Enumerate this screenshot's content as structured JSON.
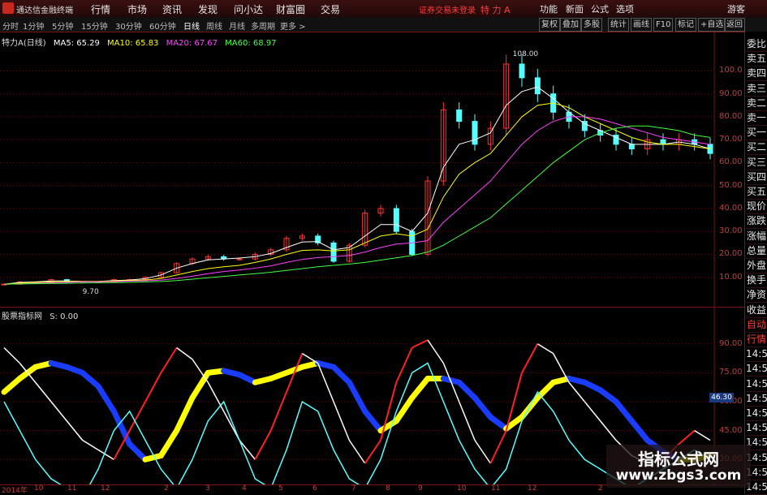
{
  "app_title": "通达信金融终端",
  "menu": [
    "行情",
    "市场",
    "资讯",
    "发现",
    "问小达",
    "财富圈",
    "交易"
  ],
  "login_note": "证券交易未登录",
  "stock_title": "特 力 A",
  "top_right": [
    "功能",
    "新面",
    "公式",
    "选项",
    "游客"
  ],
  "periods": [
    "分时",
    "1分钟",
    "5分钟",
    "15分钟",
    "30分钟",
    "60分钟",
    "日线",
    "周线",
    "月线",
    "多周期",
    "更多 >"
  ],
  "active_period": "日线",
  "toolbar_right": [
    "复权",
    "叠加",
    "多股",
    "统计",
    "画线",
    "F10",
    "标记",
    "+自选",
    "返回"
  ],
  "legend": {
    "name": "特力A(日线)",
    "ma5": "MA5: 65.29",
    "ma10": "MA10: 65.83",
    "ma20": "MA20: 67.67",
    "ma60": "MA60: 68.97"
  },
  "sub_legend": {
    "name": "股票指标网",
    "s": "S: 0.00"
  },
  "side_items": [
    "委比",
    "卖五",
    "卖四",
    "卖三",
    "卖二",
    "卖一",
    "买一",
    "买二",
    "买三",
    "买四",
    "买五",
    "现价",
    "涨跌",
    "涨幅",
    "总量",
    "外盘",
    "换手",
    "净资",
    "收益",
    "自动",
    "行情",
    "14:5",
    "14:5",
    "14:5",
    "14:5",
    "14:5",
    "14:5",
    "14:5",
    "14:5",
    "14:5",
    "14:5"
  ],
  "price_ticks": [
    "100.0",
    "90.00",
    "80.00",
    "70.00",
    "60.00",
    "50.00",
    "40.00",
    "30.00",
    "20.00",
    "10.00"
  ],
  "osc_ticks": [
    "90.00",
    "75.00",
    "60.00",
    "45.00",
    "30.00"
  ],
  "high_label": "108.00",
  "low_label": "9.70",
  "osc_current": "46.30",
  "x_labels": [
    "2014年",
    "10",
    "11",
    "12",
    "2",
    "3",
    "4",
    "5",
    "6",
    "7",
    "8",
    "9",
    "10",
    "11",
    "12",
    "2"
  ],
  "watermark": {
    "line1": "指标公式网",
    "line2": "www.zbgs3.com"
  },
  "colors": {
    "ma5": "#ffffff",
    "ma10": "#ffff00",
    "ma20": "#ff40ff",
    "ma60": "#40ff40",
    "up": "#ff3232",
    "down": "#54ffff",
    "band_up": "#ffff00",
    "band_down": "#1a3cff"
  },
  "chart_data": {
    "type": "line",
    "title": "特力A(日线)",
    "ylim": [
      0,
      115
    ],
    "series": [
      {
        "name": "close",
        "values": [
          7,
          8,
          8,
          9,
          8,
          8,
          8,
          9,
          9,
          10,
          12,
          16,
          18,
          19,
          18,
          18,
          20,
          22,
          27,
          28,
          25,
          17,
          24,
          38,
          40,
          30,
          20,
          52,
          83,
          78,
          68,
          75,
          103,
          97,
          90,
          82,
          78,
          74,
          72,
          68,
          66,
          70,
          68,
          70,
          68,
          64
        ]
      },
      {
        "name": "MA5",
        "values": [
          7,
          7.8,
          8,
          8.4,
          8.4,
          8.2,
          8.2,
          8.6,
          8.8,
          9.4,
          11,
          14,
          16,
          17.6,
          18,
          18.4,
          19,
          20.4,
          23,
          25.4,
          25.6,
          22,
          23,
          28,
          33,
          33,
          30,
          38,
          58,
          68,
          70,
          73,
          85,
          91,
          93,
          88,
          82,
          77,
          74,
          71,
          68,
          68,
          68,
          69,
          68,
          66
        ]
      },
      {
        "name": "MA10",
        "values": [
          7,
          7.5,
          7.8,
          8,
          8.2,
          8.2,
          8.2,
          8.4,
          8.6,
          8.8,
          9.5,
          11,
          12.5,
          13.8,
          14.6,
          15.2,
          16.5,
          18,
          20,
          21.7,
          22,
          21.5,
          22,
          25,
          28,
          29,
          28,
          31,
          45,
          55,
          60,
          64,
          72,
          80,
          85,
          86,
          84,
          80,
          77,
          74,
          71,
          69,
          68,
          68,
          67,
          66
        ]
      },
      {
        "name": "MA20",
        "values": [
          7,
          7.2,
          7.4,
          7.6,
          7.8,
          8,
          8,
          8.1,
          8.3,
          8.5,
          8.8,
          9.5,
          10.5,
          11.6,
          12.5,
          13.2,
          14,
          15,
          16.5,
          17.8,
          18.6,
          19,
          19.5,
          21,
          23,
          24.5,
          25,
          26,
          34,
          40,
          46,
          52,
          60,
          68,
          74,
          78,
          80,
          80,
          79,
          77,
          75,
          73,
          71,
          70,
          69,
          68
        ]
      },
      {
        "name": "MA60",
        "values": [
          7,
          7.1,
          7.2,
          7.3,
          7.4,
          7.5,
          7.6,
          7.7,
          7.8,
          8,
          8.2,
          8.6,
          9.2,
          9.8,
          10.4,
          11,
          11.6,
          12.2,
          13,
          13.8,
          14.6,
          15.2,
          15.8,
          16.5,
          17.5,
          18.5,
          19.5,
          21,
          24,
          28,
          32,
          36,
          42,
          48,
          54,
          60,
          65,
          70,
          73,
          75,
          76,
          76,
          75,
          74,
          72,
          71
        ]
      }
    ],
    "oscillator": {
      "ylim": [
        20,
        100
      ],
      "red_white": [
        88,
        80,
        70,
        60,
        50,
        40,
        35,
        30,
        45,
        60,
        75,
        88,
        82,
        70,
        55,
        40,
        30,
        45,
        65,
        85,
        80,
        60,
        40,
        28,
        40,
        70,
        88,
        92,
        80,
        60,
        40,
        28,
        45,
        75,
        90,
        85,
        70,
        60,
        50,
        40,
        32,
        28,
        30,
        38,
        45,
        40
      ],
      "cyan": [
        60,
        45,
        30,
        20,
        15,
        10,
        25,
        45,
        55,
        40,
        25,
        15,
        30,
        50,
        60,
        40,
        20,
        15,
        35,
        60,
        55,
        35,
        20,
        15,
        30,
        55,
        75,
        80,
        60,
        40,
        25,
        15,
        25,
        50,
        65,
        55,
        40,
        30,
        25,
        20,
        15,
        20,
        25,
        30,
        35,
        30
      ],
      "band": [
        65,
        72,
        78,
        80,
        78,
        75,
        68,
        55,
        38,
        30,
        32,
        45,
        62,
        75,
        76,
        74,
        70,
        72,
        75,
        78,
        80,
        78,
        70,
        55,
        45,
        50,
        62,
        72,
        72,
        70,
        62,
        52,
        46,
        52,
        62,
        70,
        72,
        70,
        66,
        60,
        50,
        40,
        34,
        30,
        30,
        32
      ]
    }
  }
}
